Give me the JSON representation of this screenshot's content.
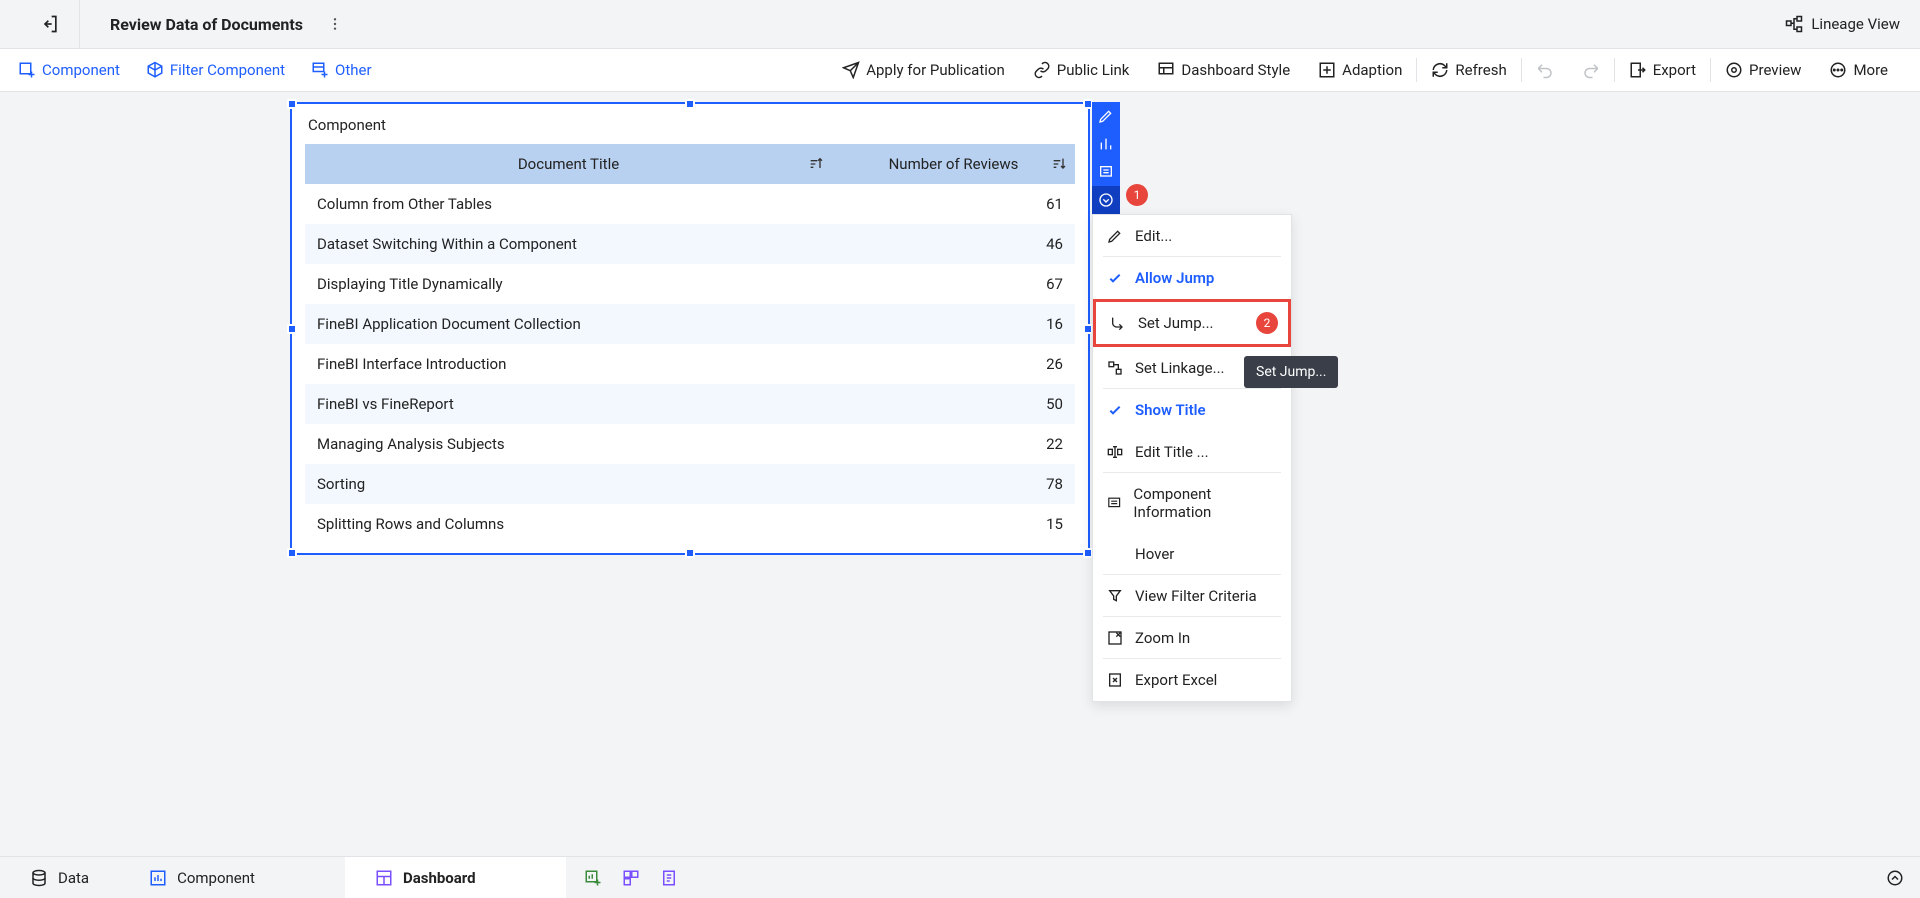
{
  "header": {
    "title": "Review Data of Documents",
    "lineage_view": "Lineage View"
  },
  "toolbar": {
    "left": {
      "component": "Component",
      "filter_component": "Filter Component",
      "other": "Other"
    },
    "right": {
      "apply": "Apply for Publication",
      "public_link": "Public Link",
      "dashboard_style": "Dashboard Style",
      "adaption": "Adaption",
      "refresh": "Refresh",
      "export": "Export",
      "preview": "Preview",
      "more": "More"
    }
  },
  "component": {
    "title": "Component",
    "columns": {
      "doc": "Document Title",
      "reviews": "Number of Reviews"
    },
    "rows": [
      {
        "title": "Column from Other Tables",
        "reviews": "61"
      },
      {
        "title": "Dataset Switching Within a Component",
        "reviews": "46"
      },
      {
        "title": "Displaying Title Dynamically",
        "reviews": "67"
      },
      {
        "title": "FineBI Application Document Collection",
        "reviews": "16"
      },
      {
        "title": "FineBI Interface Introduction",
        "reviews": "26"
      },
      {
        "title": "FineBI vs FineReport",
        "reviews": "50"
      },
      {
        "title": "Managing Analysis Subjects",
        "reviews": "22"
      },
      {
        "title": "Sorting",
        "reviews": "78"
      },
      {
        "title": "Splitting Rows and Columns",
        "reviews": "15"
      }
    ]
  },
  "context_menu": {
    "edit": "Edit...",
    "allow_jump": "Allow Jump",
    "set_jump": "Set Jump...",
    "set_linkage": "Set Linkage...",
    "show_title": "Show Title",
    "edit_title": "Edit Title ...",
    "component_info": "Component Information",
    "hover": "Hover",
    "view_filter": "View Filter Criteria",
    "zoom_in": "Zoom In",
    "export_excel": "Export Excel"
  },
  "tooltip": "Set Jump...",
  "callouts": {
    "one": "1",
    "two": "2"
  },
  "footer": {
    "data": "Data",
    "component": "Component",
    "dashboard": "Dashboard"
  }
}
